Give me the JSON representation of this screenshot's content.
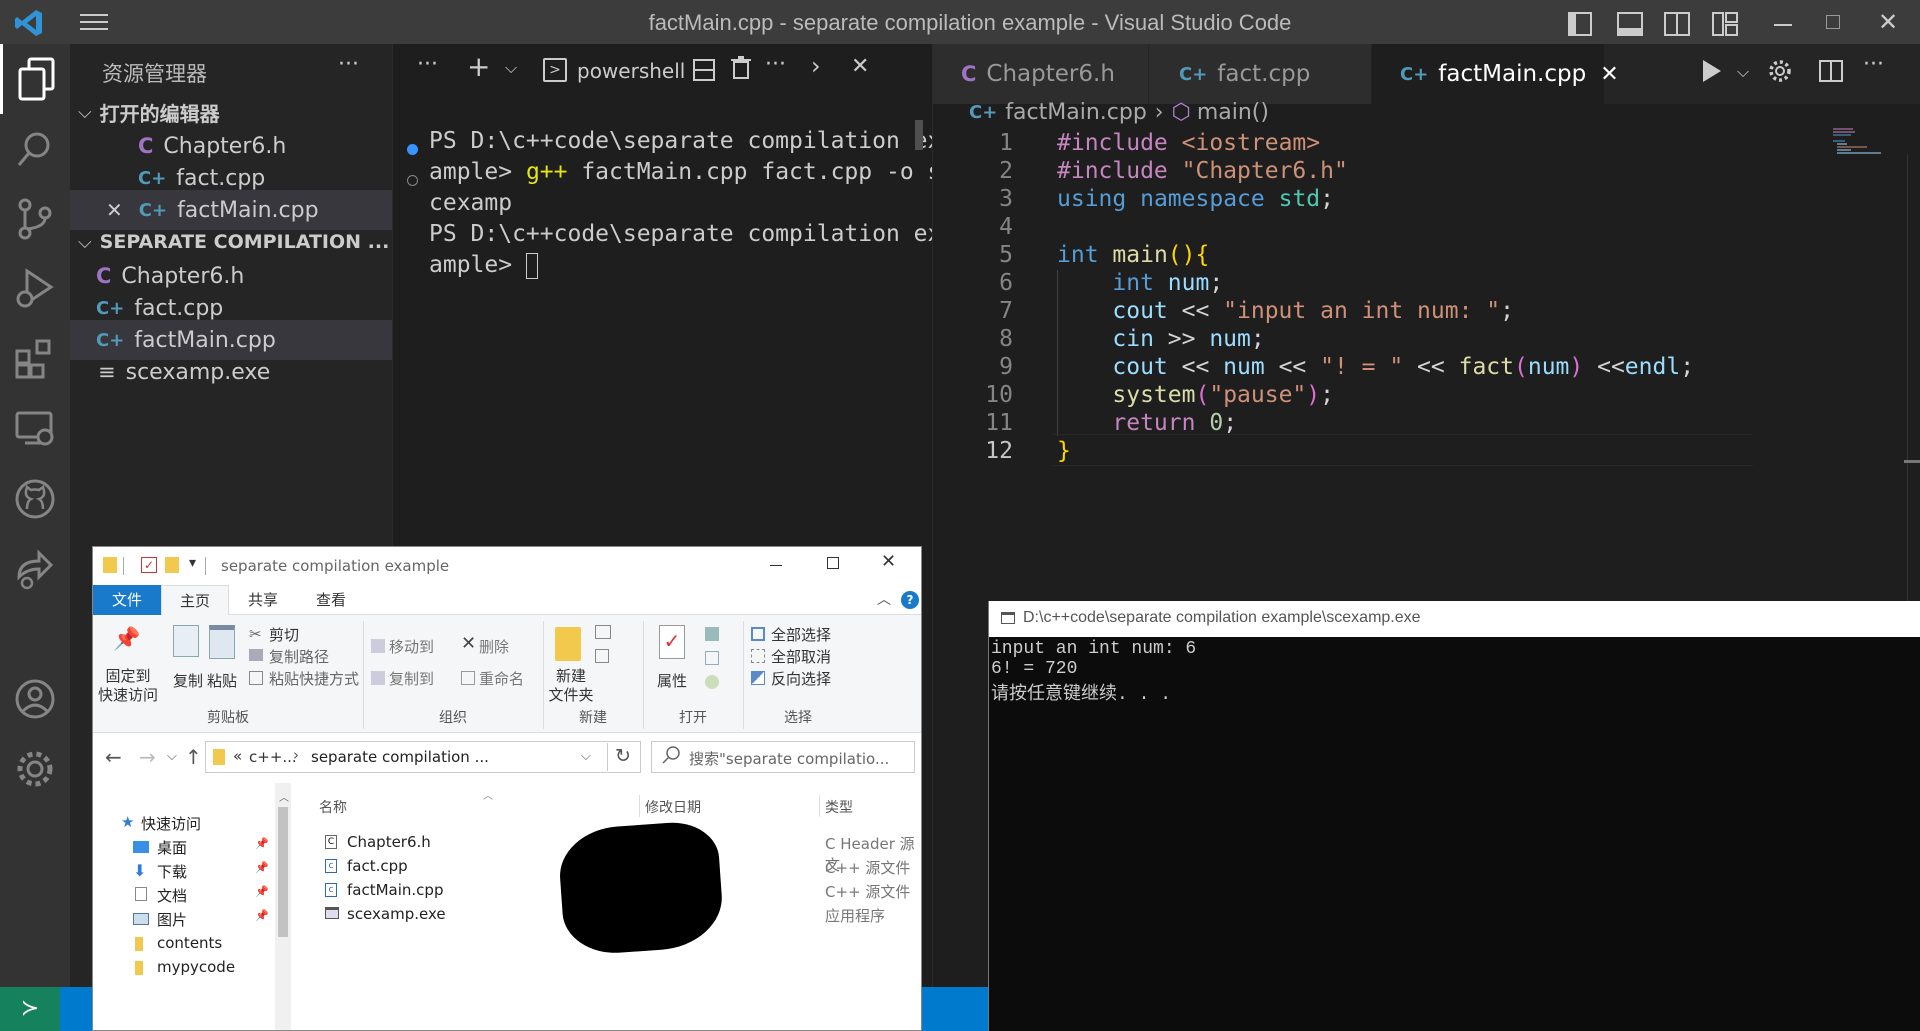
{
  "window": {
    "title": "factMain.cpp - separate compilation example - Visual Studio Code"
  },
  "sidebar": {
    "header": "资源管理器",
    "open_editors_label": "打开的编辑器",
    "open_editors": [
      {
        "icon": "C",
        "name": "Chapter6.h"
      },
      {
        "icon": "C+",
        "name": "fact.cpp"
      },
      {
        "icon": "C+",
        "name": "factMain.cpp"
      }
    ],
    "folder_label": "SEPARATE COMPILATION ...",
    "files": [
      {
        "icon": "C",
        "name": "Chapter6.h"
      },
      {
        "icon": "C+",
        "name": "fact.cpp"
      },
      {
        "icon": "C+",
        "name": "factMain.cpp"
      },
      {
        "icon": "≡",
        "name": "scexamp.exe"
      }
    ]
  },
  "terminal": {
    "shell_label": "powershell",
    "lines": [
      "PS D:\\c++code\\separate compilation ex",
      "ample> g++ factMain.cpp fact.cpp -o s",
      "cexamp",
      "PS D:\\c++code\\separate compilation ex",
      "ample> "
    ],
    "prompt_prefix": "ample> ",
    "cmd_name": "g++",
    "cmd_args": " factMain.cpp fact.cpp -o s"
  },
  "editor": {
    "tabs": [
      {
        "icon": "C",
        "label": "Chapter6.h"
      },
      {
        "icon": "C+",
        "label": "fact.cpp"
      },
      {
        "icon": "C+",
        "label": "factMain.cpp",
        "active": true
      }
    ],
    "breadcrumb": {
      "file": "factMain.cpp",
      "symbol": "main()"
    },
    "line_numbers": [
      "1",
      "2",
      "3",
      "4",
      "5",
      "6",
      "7",
      "8",
      "9",
      "10",
      "11",
      "12"
    ],
    "code_lines": [
      "#include <iostream>",
      "#include \"Chapter6.h\"",
      "using namespace std;",
      "",
      "int main(){",
      "    int num;",
      "    cout << \"input an int num: \";",
      "    cin >> num;",
      "    cout << num << \"! = \" << fact(num) <<endl;",
      "    system(\"pause\");",
      "    return 0;",
      "}"
    ]
  },
  "explorer": {
    "title": "separate compilation example",
    "ribbon_tabs": [
      "文件",
      "主页",
      "共享",
      "查看"
    ],
    "clipboard": {
      "pin": "固定到\n快速访问",
      "copy": "复制",
      "paste": "粘贴",
      "cut": "剪切",
      "copy_path": "复制路径",
      "paste_shortcut": "粘贴快捷方式",
      "group": "剪贴板"
    },
    "organize": {
      "move_to": "移动到",
      "delete": "删除",
      "copy_to": "复制到",
      "rename": "重命名",
      "group": "组织"
    },
    "new": {
      "new_folder": "新建\n文件夹",
      "group": "新建"
    },
    "open": {
      "properties": "属性",
      "group": "打开"
    },
    "select": {
      "select_all": "全部选择",
      "select_none": "全部取消",
      "invert": "反向选择",
      "group": "选择"
    },
    "address": {
      "part1": "c++...",
      "part2": "separate compilation ..."
    },
    "search_placeholder": "搜索\"separate compilatio...",
    "nav": [
      {
        "label": "快速访问"
      },
      {
        "label": "桌面"
      },
      {
        "label": "下载"
      },
      {
        "label": "文档"
      },
      {
        "label": "图片"
      },
      {
        "label": "contents"
      },
      {
        "label": "mypycode"
      }
    ],
    "columns": [
      "名称",
      "修改日期",
      "类型"
    ],
    "files": [
      {
        "name": "Chapter6.h",
        "type": "C Header 源文"
      },
      {
        "name": "fact.cpp",
        "type": "C++ 源文件"
      },
      {
        "name": "factMain.cpp",
        "type": "C++ 源文件"
      },
      {
        "name": "scexamp.exe",
        "type": "应用程序"
      }
    ]
  },
  "console": {
    "title": "D:\\c++code\\separate compilation example\\scexamp.exe",
    "lines": [
      "input an int num: 6",
      "6! = 720",
      "请按任意键继续. . ."
    ]
  },
  "colors": {
    "accent": "#007acc",
    "remote": "#16825d"
  }
}
